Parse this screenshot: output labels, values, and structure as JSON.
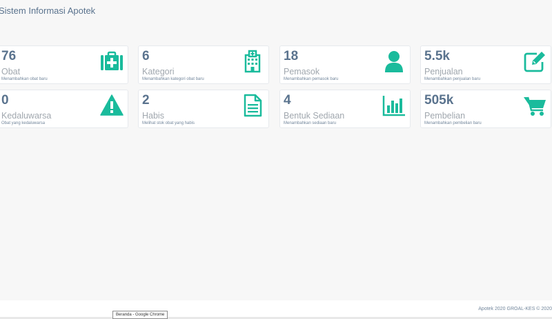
{
  "header": {
    "title": "Sistem Informasi Apotek"
  },
  "theme": {
    "accent": "#1abb9c",
    "count_color": "#5a738e",
    "label_color": "#a0a7ae"
  },
  "cards": [
    {
      "count": "76",
      "label": "Obat",
      "desc": "Menambahkan obat baru",
      "icon": "medkit-icon"
    },
    {
      "count": "6",
      "label": "Kategori",
      "desc": "Menambahkan kategori obat baru",
      "icon": "hospital-icon"
    },
    {
      "count": "18",
      "label": "Pemasok",
      "desc": "Menambahkan pemasok baru",
      "icon": "user-icon"
    },
    {
      "count": "5.5k",
      "label": "Penjualan",
      "desc": "Menambahkan penjualan baru",
      "icon": "edit-icon"
    },
    {
      "count": "0",
      "label": "Kedaluwarsa",
      "desc": "Obat yang kedaluwarsa",
      "icon": "warning-icon"
    },
    {
      "count": "2",
      "label": "Habis",
      "desc": "Melihat stok obat yang habis",
      "icon": "file-text-icon"
    },
    {
      "count": "4",
      "label": "Bentuk Sediaan",
      "desc": "Menambahkan sediaan baru",
      "icon": "bar-chart-icon"
    },
    {
      "count": "505k",
      "label": "Pembelian",
      "desc": "Menambahkan pembelian baru",
      "icon": "shopping-cart-icon"
    }
  ],
  "footer": {
    "text": "Apotek 2020 GROAL-KES © 2020"
  },
  "tooltip": {
    "text": "Beranda - Google Chrome"
  }
}
